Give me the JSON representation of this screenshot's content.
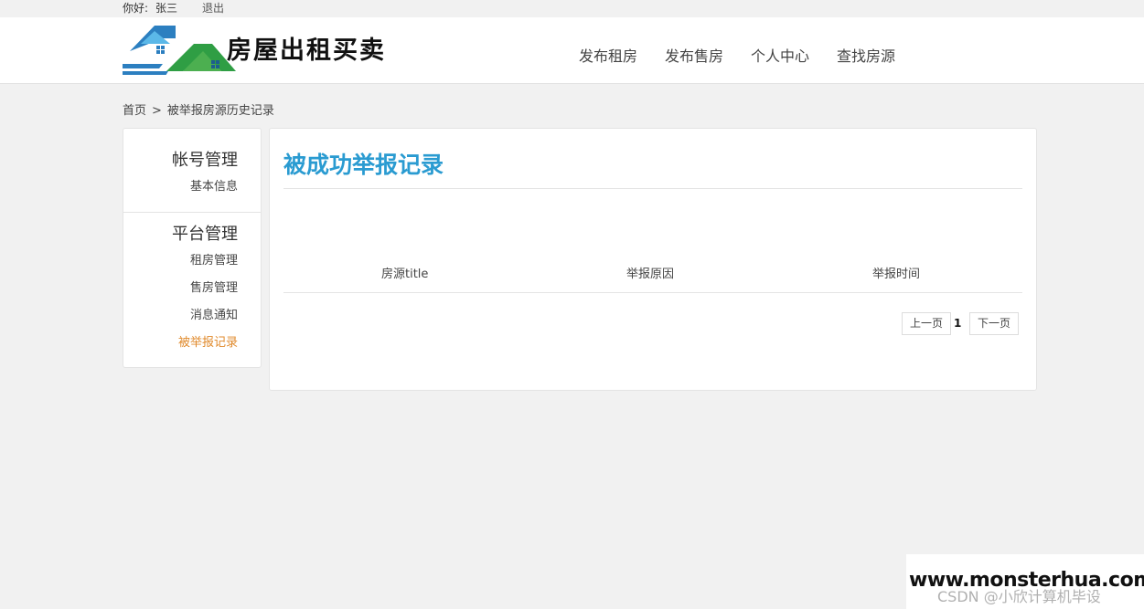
{
  "topbar": {
    "greeting": "你好:",
    "username": "张三",
    "logout": "退出"
  },
  "header": {
    "logo_text": "房屋出租买卖",
    "nav": [
      "发布租房",
      "发布售房",
      "个人中心",
      "查找房源"
    ]
  },
  "breadcrumb": {
    "home": "首页",
    "separator": ">",
    "current": "被举报房源历史记录"
  },
  "sidebar": {
    "group1": {
      "title": "帐号管理",
      "items": [
        "基本信息"
      ]
    },
    "group2": {
      "title": "平台管理",
      "items": [
        "租房管理",
        "售房管理",
        "消息通知",
        "被举报记录"
      ]
    },
    "active_item": "被举报记录"
  },
  "content": {
    "title": "被成功举报记录",
    "columns": [
      "房源title",
      "举报原因",
      "举报时间"
    ],
    "rows": [],
    "pager": {
      "prev": "上一页",
      "current": "1",
      "next": "下一页"
    }
  },
  "watermark": {
    "url": "www.monsterhua.com",
    "csdn": "CSDN @小欣计算机毕设"
  },
  "colors": {
    "accent": "#2a9bd1",
    "active": "#e08a2c",
    "logo_blue": "#2c7fc0",
    "logo_green": "#4caf50"
  }
}
